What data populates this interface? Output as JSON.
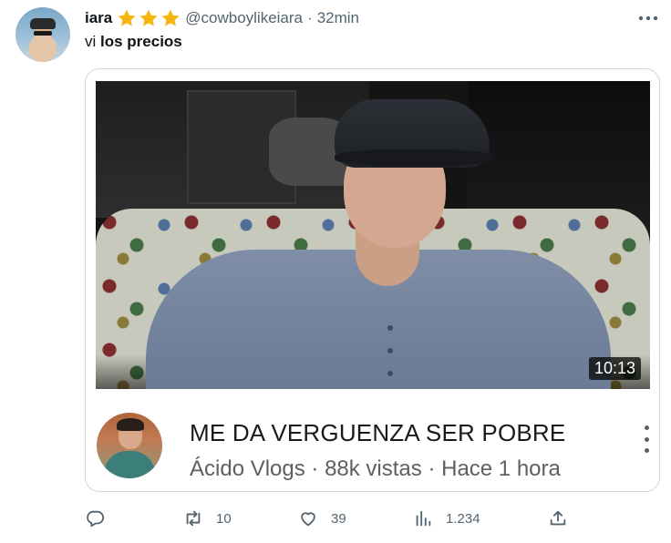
{
  "tweet": {
    "display_name": "iara",
    "stars": [
      "star-icon",
      "star-icon",
      "star-icon"
    ],
    "handle": "@cowboylikeiara",
    "separator": "·",
    "time": "32min",
    "text_plain": "vi ",
    "text_bold": "los precios"
  },
  "video": {
    "duration": "10:13",
    "title": "ME DA VERGUENZA SER POBRE",
    "meta": "Ácido Vlogs · 88k vistas · Hace 1 hora"
  },
  "actions": {
    "reply": {
      "icon": "reply-icon",
      "count": ""
    },
    "retweet": {
      "icon": "retweet-icon",
      "count": "10"
    },
    "like": {
      "icon": "heart-icon",
      "count": "39"
    },
    "views": {
      "icon": "views-icon",
      "count": "1.234"
    },
    "share": {
      "icon": "share-icon",
      "count": ""
    }
  },
  "colors": {
    "secondary_text": "#536471",
    "star": "#f5b50a",
    "border": "#cfd9de"
  }
}
